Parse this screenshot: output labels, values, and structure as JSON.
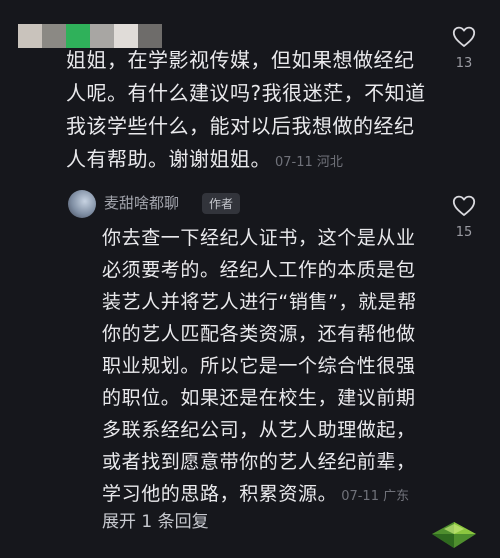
{
  "comment": {
    "text": "姐姐，在学影视传媒，但如果想做经纪人呢。有什么建议吗?我很迷茫，不知道我该学些什么，能对以后我想做的经纪人有帮助。谢谢姐姐。",
    "time": "07-11",
    "location": "河北",
    "likes": "13",
    "mosaic_colors": [
      "#c9c3bc",
      "#8b8984",
      "#2fb15a",
      "#a8a6a3",
      "#e0dcd8",
      "#6e6c6a"
    ]
  },
  "reply": {
    "author": "麦甜啥都聊",
    "badge": "作者",
    "text": "你去查一下经纪人证书，这个是从业必须要考的。经纪人工作的本质是包装艺人并将艺人进行“销售”，就是帮你的艺人匹配各类资源，还有帮他做职业规划。所以它是一个综合性很强的职位。如果还是在校生，建议前期多联系经纪公司，从艺人助理做起，或者找到愿意带你的艺人经纪前辈，学习他的思路，积累资源。",
    "time": "07-11",
    "location": "广东",
    "likes": "15"
  },
  "expand_label": "展开 1 条回复",
  "icons": {
    "heart": "heart-outline-icon",
    "watermark": "green-crystal-logo-icon"
  },
  "colors": {
    "background": "#16171c",
    "text": "#e9e9ec",
    "meta": "#70727a",
    "badge_bg": "#32343b"
  }
}
